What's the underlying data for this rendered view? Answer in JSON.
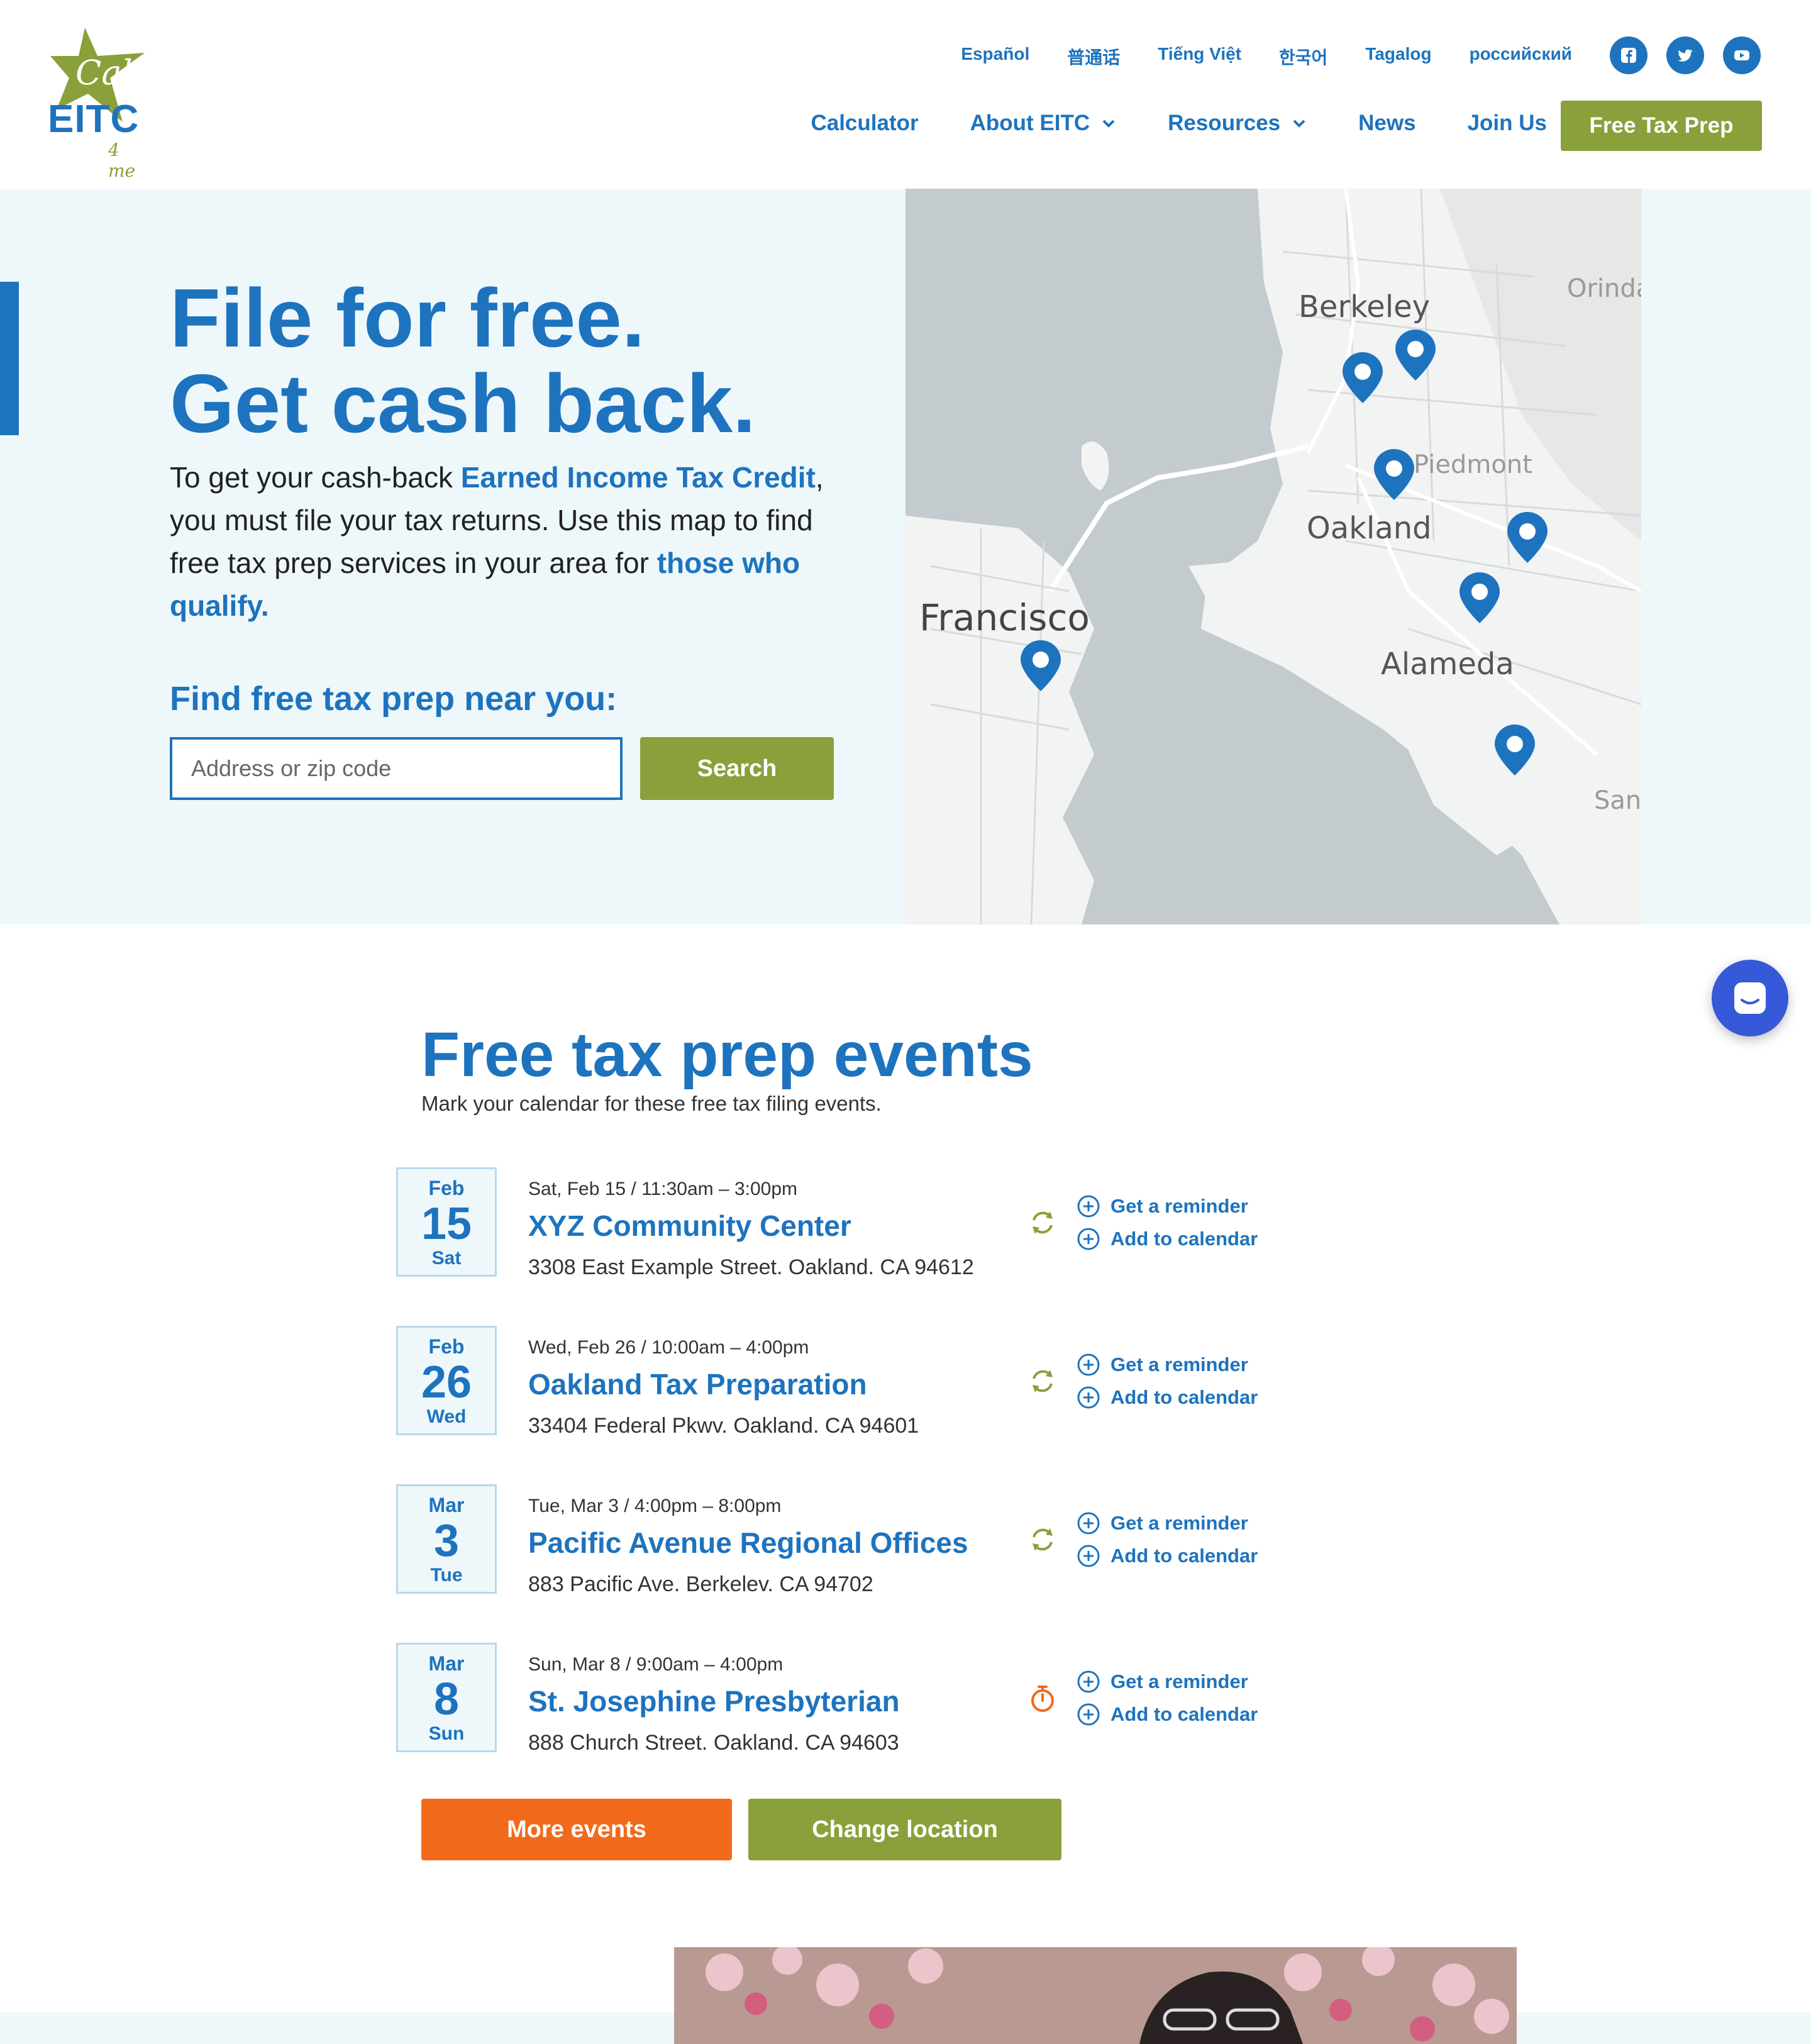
{
  "header": {
    "logo": {
      "cal": "Cal",
      "eitc": "EITC",
      "four_me": "4 me"
    },
    "languages": [
      "Español",
      "普通话",
      "Tiếng Việt",
      "한국어",
      "Tagalog",
      "российский"
    ],
    "social_icons": [
      "facebook-icon",
      "twitter-icon",
      "youtube-icon"
    ],
    "nav": {
      "calculator": "Calculator",
      "about": "About EITC",
      "resources": "Resources",
      "news": "News",
      "join": "Join Us",
      "cta": "Free Tax Prep"
    }
  },
  "hero": {
    "title_line1": "File for free.",
    "title_line2": "Get cash back.",
    "text_1": "To get your cash-back ",
    "text_link_1": "Earned Income Tax Credit",
    "text_2": ", you must file your tax returns. Use this map to find free tax prep services in your area for ",
    "text_link_2": "those who qualify.",
    "find_label": "Find free tax prep near you:",
    "search_placeholder": "Address or zip code",
    "search_button": "Search"
  },
  "map": {
    "labels": {
      "berkeley": "Berkeley",
      "orinda": "Orinda",
      "piedmont": "Piedmont",
      "oakland": "Oakland",
      "francisco": "Francisco",
      "alameda": "Alameda",
      "san": "San"
    },
    "pin_count": 7
  },
  "events": {
    "title": "Free tax prep events",
    "subtitle": "Mark your calendar for these free tax filing events.",
    "reminder_label": "Get a reminder",
    "calendar_label": "Add to calendar",
    "items": [
      {
        "month": "Feb",
        "day": "15",
        "weekday": "Sat",
        "when": "Sat, Feb 15 / 11:30am – 3:00pm",
        "name": "XYZ Community Center",
        "address": "3308 East Example Street. Oakland. CA 94612",
        "status_icon": "recurring-icon"
      },
      {
        "month": "Feb",
        "day": "26",
        "weekday": "Wed",
        "when": "Wed, Feb 26 / 10:00am – 4:00pm",
        "name": "Oakland Tax Preparation",
        "address": "33404 Federal Pkwv. Oakland. CA 94601",
        "status_icon": "recurring-icon"
      },
      {
        "month": "Mar",
        "day": "3",
        "weekday": "Tue",
        "when": "Tue, Mar 3 / 4:00pm – 8:00pm",
        "name": "Pacific Avenue Regional Offices",
        "address": "883 Pacific Ave. Berkelev. CA 94702",
        "status_icon": "recurring-icon"
      },
      {
        "month": "Mar",
        "day": "8",
        "weekday": "Sun",
        "when": "Sun, Mar 8 / 9:00am – 4:00pm",
        "name": "St. Josephine Presbyterian",
        "address": "888 Church Street. Oakland. CA 94603",
        "status_icon": "timer-icon"
      }
    ],
    "more_button": "More events",
    "change_button": "Change location"
  },
  "colors": {
    "primary_blue": "#1e73be",
    "green": "#8aa03a",
    "orange": "#f26a1b",
    "hero_bg": "#eef8fb",
    "chat_blue": "#3659d9"
  }
}
